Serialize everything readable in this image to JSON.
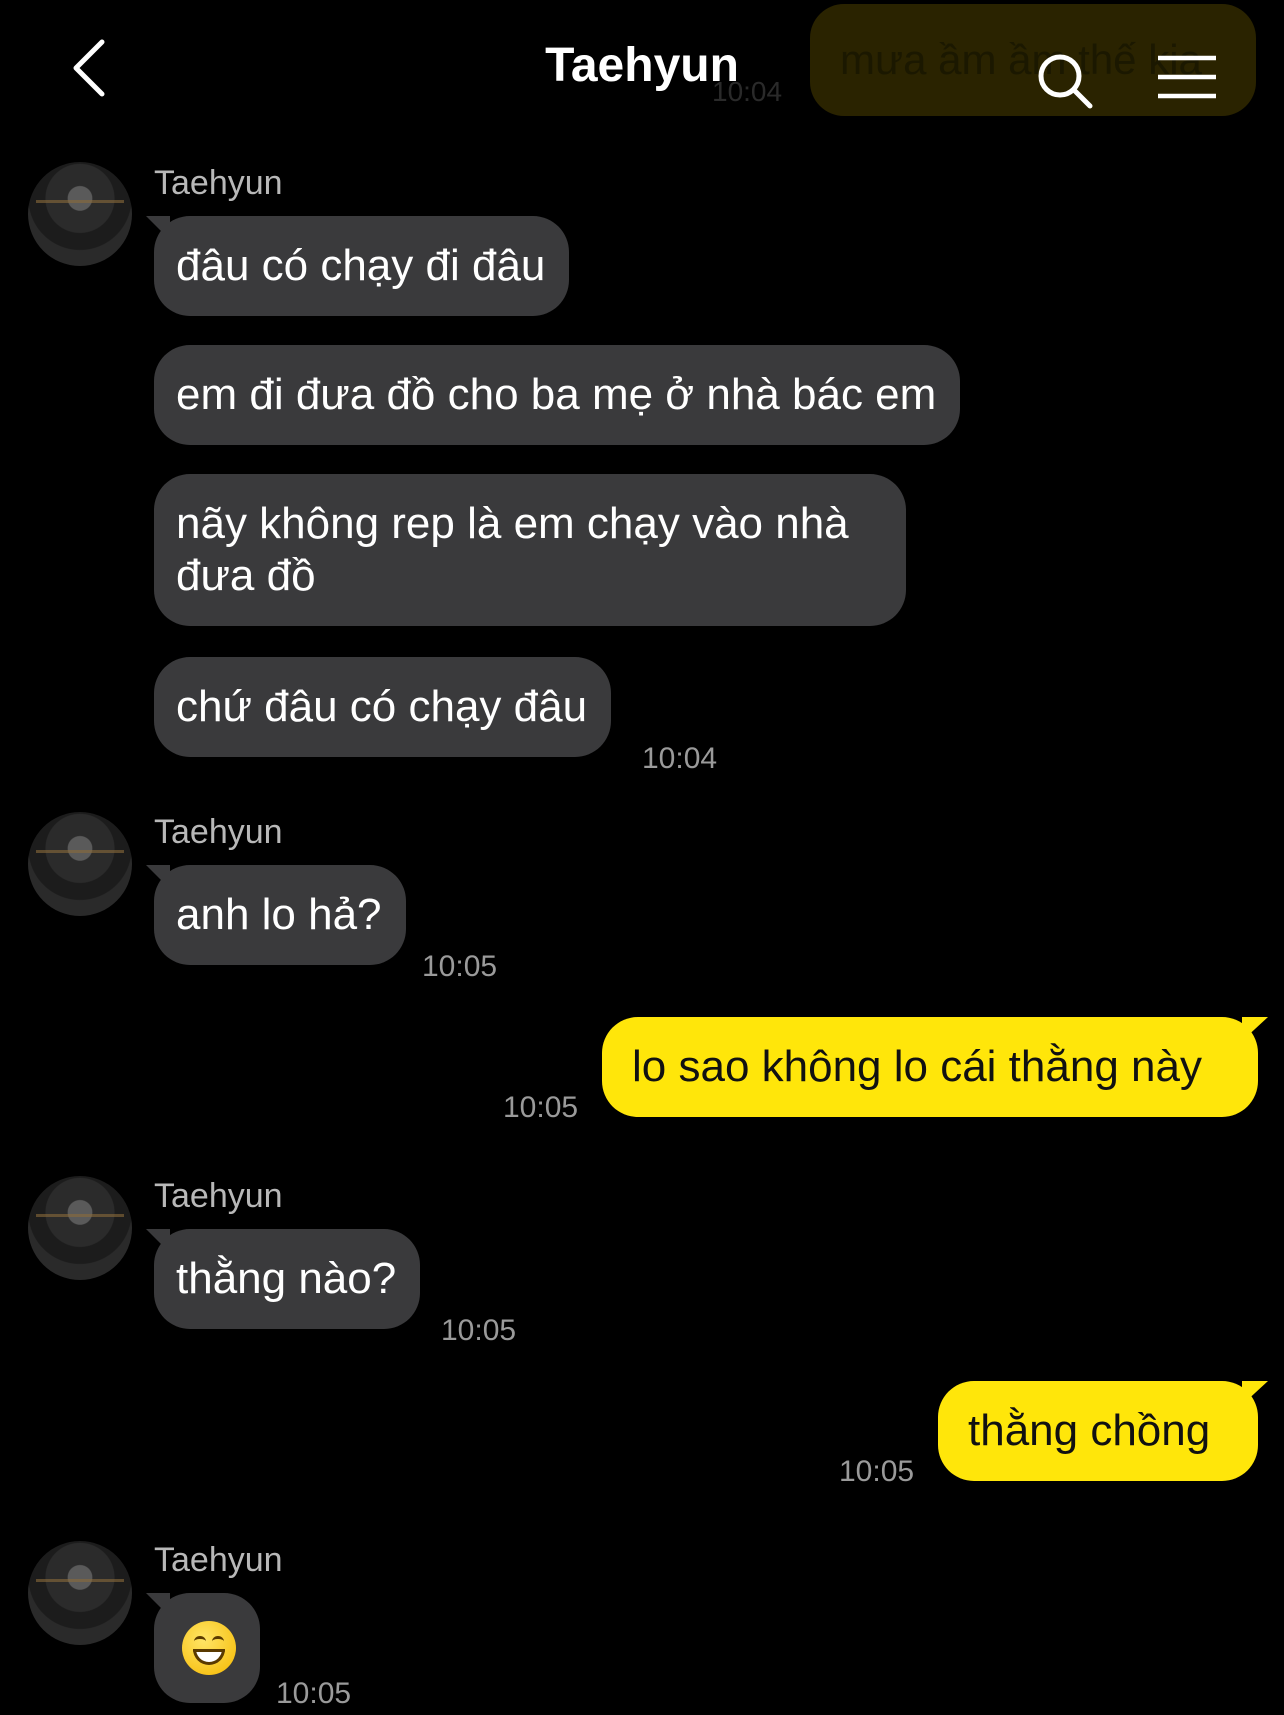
{
  "header": {
    "title": "Taehyun",
    "peek_message": "mưa ầm ầm thế kia",
    "peek_time": "10:04"
  },
  "groups": [
    {
      "sender": "Taehyun",
      "messages": [
        "đâu có chạy đi đâu",
        "em đi đưa đồ cho ba mẹ ở nhà bác em",
        "nãy không rep là em chạy vào nhà đưa đồ",
        "chứ đâu có chạy đâu"
      ],
      "time": "10:04"
    },
    {
      "sender": "Taehyun",
      "messages": [
        "anh lo hả?"
      ],
      "time": "10:05"
    },
    {
      "sender": "me",
      "messages": [
        "lo sao không lo cái thằng này"
      ],
      "time": "10:05"
    },
    {
      "sender": "Taehyun",
      "messages": [
        "thằng nào?"
      ],
      "time": "10:05"
    },
    {
      "sender": "me",
      "messages": [
        "thằng chồng"
      ],
      "time": "10:05"
    },
    {
      "sender": "Taehyun",
      "messages": [
        "grinning-emoji"
      ],
      "time": "10:05"
    }
  ],
  "colors": {
    "background": "#000000",
    "incoming_bubble": "#3a3a3c",
    "outgoing_bubble": "#ffe60a",
    "timestamp": "#9a9a9a"
  }
}
